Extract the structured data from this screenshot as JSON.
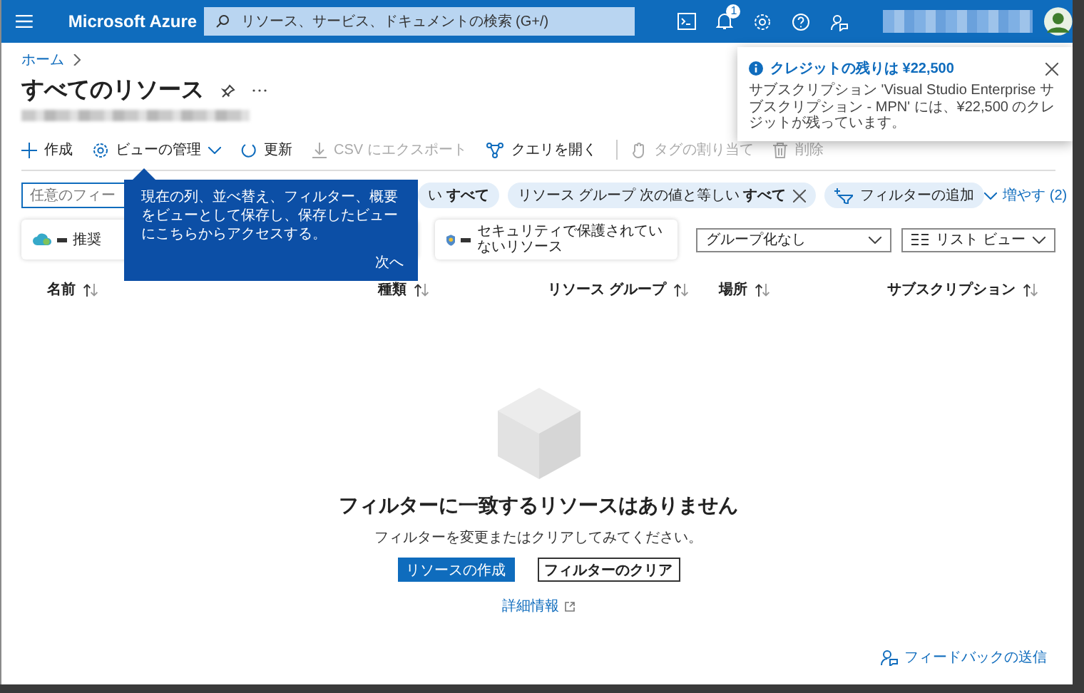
{
  "top_bar": {
    "brand": "Microsoft Azure",
    "search": {
      "placeholder": "リソース、サービス、ドキュメントの検索 (G+/)"
    },
    "notification_count": "1"
  },
  "breadcrumb": [
    "ホーム"
  ],
  "page": {
    "title": "すべてのリソース"
  },
  "toolbar": [
    {
      "label": "作成",
      "disabled": false,
      "dropdown": false
    },
    {
      "label": "ビューの管理",
      "disabled": false,
      "dropdown": true
    },
    {
      "label": "更新",
      "disabled": false,
      "dropdown": false
    },
    {
      "label": "CSV にエクスポート",
      "disabled": true,
      "dropdown": false
    },
    {
      "label": "クエリを開く",
      "disabled": false,
      "dropdown": false
    },
    {
      "label": "タグの割り当て",
      "disabled": true,
      "dropdown": false
    },
    {
      "label": "削除",
      "disabled": true,
      "dropdown": false
    }
  ],
  "filters": {
    "search": {
      "placeholder": "任意のフィー"
    },
    "pills": [
      {
        "text": "い **すべて**",
        "removable": false
      },
      {
        "text": "リソース グループ 次の値と等しい **すべて**",
        "removable": true
      }
    ],
    "add_filter": "フィルターの追加",
    "more": "増やす (2)"
  },
  "cards": [
    {
      "text": "推奨"
    },
    {
      "text": "セキュリティで保護されていないリソース"
    }
  ],
  "dropdowns": [
    {
      "value": "グループ化なし"
    },
    {
      "value": "リスト ビュー"
    }
  ],
  "table": {
    "columns": [
      {
        "label": "名前"
      },
      {
        "label": "種類"
      },
      {
        "label": "リソース グループ"
      },
      {
        "label": "場所"
      },
      {
        "label": "サブスクリプション"
      }
    ]
  },
  "empty_state": {
    "title": "フィルターに一致するリソースはありません",
    "message": "フィルターを変更またはクリアしてみてください。",
    "primary_button": "リソースの作成",
    "secondary_button": "フィルターのクリア",
    "link": "詳細情報"
  },
  "feedback": "フィードバックの送信",
  "tooltip": {
    "text": "現在の列、並べ替え、フィルター、概要をビューとして保存し、保存したビューにこちらからアクセスする。",
    "next": "次へ"
  },
  "notification": {
    "title": "クレジットの残りは ¥22,500",
    "message": "サブスクリプション 'Visual Studio Enterprise サブスクリプション - MPN' には、¥22,500 のクレジットが残っています。"
  }
}
